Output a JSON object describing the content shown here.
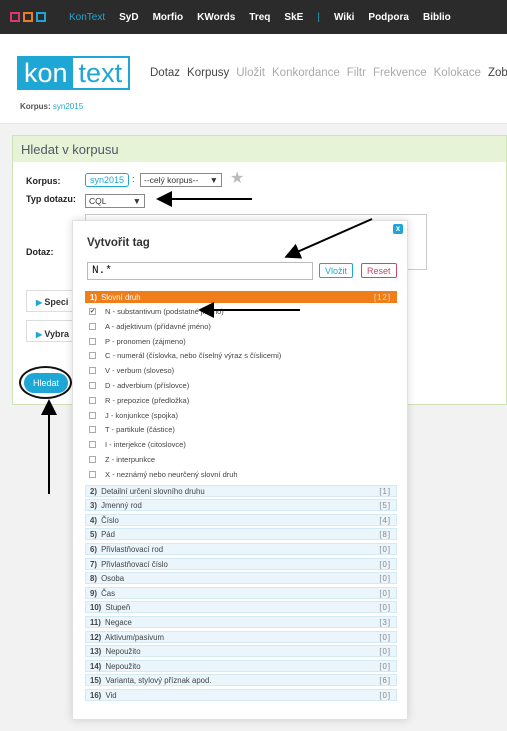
{
  "topbar": {
    "nav": [
      "KonText",
      "SyD",
      "Morfio",
      "KWords",
      "Treq",
      "SkE",
      "|",
      "Wiki",
      "Podpora",
      "Biblio"
    ]
  },
  "brand": {
    "part1": "kon",
    "part2": "text"
  },
  "menu": [
    "Dotaz",
    "Korpusy",
    "Uložit",
    "Konkordance",
    "Filtr",
    "Frekvence",
    "Kolokace",
    "Zobra"
  ],
  "corpus_line": {
    "label": "Korpus:",
    "value": "syn2015"
  },
  "search": {
    "title": "Hledat v korpusu",
    "corpus_label": "Korpus:",
    "corpus_value": "syn2015",
    "subcorpus_value": "--celý korpus--",
    "query_type_label": "Typ dotazu:",
    "query_type_value": "CQL",
    "query_label": "Dotaz:",
    "specify_label": "Speci",
    "select_label": "Vybra",
    "submit_label": "Hledat"
  },
  "tag_builder": {
    "title": "Vytvořit tag",
    "input_value": "N.*",
    "insert_label": "Vložit",
    "reset_label": "Reset",
    "close_label": "x",
    "groups": [
      {
        "num": "1)",
        "name": "Slovní druh",
        "count": "[12]",
        "open": true
      },
      {
        "num": "2)",
        "name": "Detailní určení slovního druhu",
        "count": "[1]"
      },
      {
        "num": "3)",
        "name": "Jmenný rod",
        "count": "[5]"
      },
      {
        "num": "4)",
        "name": "Číslo",
        "count": "[4]"
      },
      {
        "num": "5)",
        "name": "Pád",
        "count": "[8]"
      },
      {
        "num": "6)",
        "name": "Přivlastňovací rod",
        "count": "[0]"
      },
      {
        "num": "7)",
        "name": "Přivlastňovací číslo",
        "count": "[0]"
      },
      {
        "num": "8)",
        "name": "Osoba",
        "count": "[0]"
      },
      {
        "num": "9)",
        "name": "Čas",
        "count": "[0]"
      },
      {
        "num": "10)",
        "name": "Stupeň",
        "count": "[0]"
      },
      {
        "num": "11)",
        "name": "Negace",
        "count": "[3]"
      },
      {
        "num": "12)",
        "name": "Aktivum/pasivum",
        "count": "[0]"
      },
      {
        "num": "13)",
        "name": "Nepoužito",
        "count": "[0]"
      },
      {
        "num": "14)",
        "name": "Nepoužito",
        "count": "[0]"
      },
      {
        "num": "15)",
        "name": "Varianta, stylový příznak apod.",
        "count": "[6]"
      },
      {
        "num": "16)",
        "name": "Vid",
        "count": "[0]"
      }
    ],
    "options": [
      {
        "label": "N - substantivum (podstatné jméno)",
        "checked": true
      },
      {
        "label": "A - adjektivum (přídavné jméno)",
        "checked": false
      },
      {
        "label": "P - pronomen (zájmeno)",
        "checked": false
      },
      {
        "label": "C - numerál (číslovka, nebo číselný výraz s číslicemi)",
        "checked": false
      },
      {
        "label": "V - verbum (sloveso)",
        "checked": false
      },
      {
        "label": "D - adverbium (příslovce)",
        "checked": false
      },
      {
        "label": "R - prepozice (předložka)",
        "checked": false
      },
      {
        "label": "J - konjunkce (spojka)",
        "checked": false
      },
      {
        "label": "T - partikule (částice)",
        "checked": false
      },
      {
        "label": "I - interjekce (citoslovce)",
        "checked": false
      },
      {
        "label": "Z - interpunkce",
        "checked": false
      },
      {
        "label": "X - neznámý nebo neurčený slovní druh",
        "checked": false
      }
    ]
  },
  "colors": {
    "accent": "#1ea7d4",
    "open_group": "#ef7d1a",
    "reset": "#c24d6a",
    "panel_header": "#e6f3d6"
  }
}
